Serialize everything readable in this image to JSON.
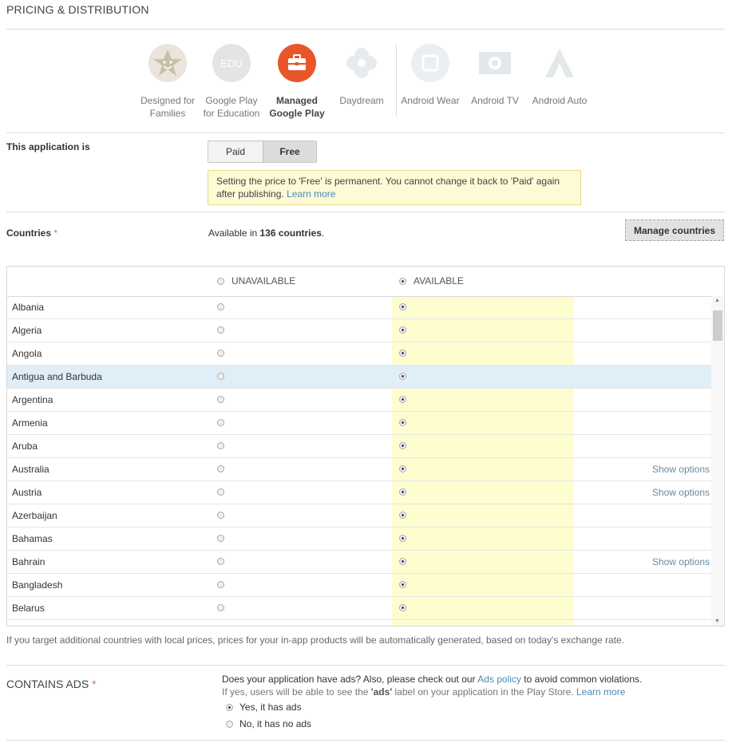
{
  "section": {
    "title": "PRICING & DISTRIBUTION"
  },
  "devices": [
    {
      "line1": "Designed for",
      "line2": "Families",
      "icon": "star-face-icon",
      "active": false
    },
    {
      "line1": "Google Play",
      "line2": "for Education",
      "icon": "edu-icon",
      "active": false
    },
    {
      "line1": "Managed",
      "line2": "Google Play",
      "icon": "briefcase-icon",
      "active": true
    },
    {
      "line1": "Daydream",
      "line2": "",
      "icon": "daydream-icon",
      "active": false
    },
    {
      "line1": "Android Wear",
      "line2": "",
      "icon": "watch-icon",
      "active": false
    },
    {
      "line1": "Android TV",
      "line2": "",
      "icon": "tv-icon",
      "active": false
    },
    {
      "line1": "Android Auto",
      "line2": "",
      "icon": "auto-icon",
      "active": false
    }
  ],
  "pricing": {
    "label": "This application is",
    "paid": "Paid",
    "free": "Free",
    "notice": "Setting the price to 'Free' is permanent. You cannot change it back to 'Paid' again after publishing.",
    "notice_link": "Learn more"
  },
  "countries": {
    "label": "Countries",
    "required_mark": "*",
    "available_prefix": "Available in",
    "available_count": "136 countries",
    "available_suffix": ".",
    "manage_button": "Manage countries",
    "col_unavailable": "UNAVAILABLE",
    "col_available": "AVAILABLE",
    "show_options": "Show options",
    "rows": [
      {
        "name": "Albania",
        "options": false
      },
      {
        "name": "Algeria",
        "options": false
      },
      {
        "name": "Angola",
        "options": false
      },
      {
        "name": "Antigua and Barbuda",
        "options": false,
        "highlight": true
      },
      {
        "name": "Argentina",
        "options": false
      },
      {
        "name": "Armenia",
        "options": false
      },
      {
        "name": "Aruba",
        "options": false
      },
      {
        "name": "Australia",
        "options": true
      },
      {
        "name": "Austria",
        "options": true
      },
      {
        "name": "Azerbaijan",
        "options": false
      },
      {
        "name": "Bahamas",
        "options": false
      },
      {
        "name": "Bahrain",
        "options": true
      },
      {
        "name": "Bangladesh",
        "options": false
      },
      {
        "name": "Belarus",
        "options": false
      }
    ],
    "note": "If you target additional countries with local prices, prices for your in-app products will be automatically generated, based on today's exchange rate."
  },
  "ads": {
    "title": "CONTAINS ADS",
    "required_mark": "*",
    "question_prefix": "Does your application have ads? Also, please check out our",
    "policy_link": "Ads policy",
    "question_suffix": "to avoid common violations.",
    "sub_prefix": "If yes, users will be able to see the",
    "sub_bold": "'ads'",
    "sub_suffix": "label on your application in the Play Store.",
    "sub_link": "Learn more",
    "yes": "Yes, it has ads",
    "no": "No, it has no ads",
    "selected": "yes"
  },
  "colors": {
    "accent": "#e8562a",
    "link": "#4a8bb5",
    "available_bg": "#fdfdd0",
    "highlight_row": "#e0eef7"
  }
}
